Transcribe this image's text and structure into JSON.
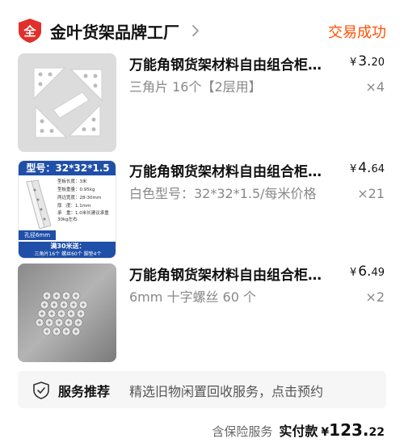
{
  "shop": {
    "logo_text": "全",
    "name": "金叶货架品牌工厂",
    "status": "交易成功"
  },
  "items": [
    {
      "title": "万能角钢货架材料自由组合柜架配件",
      "spec": "三角片 16个【2层用】",
      "currency": "¥",
      "price_int": "3.",
      "price_dec": "20",
      "qty": "×4"
    },
    {
      "title": "万能角钢货架材料自由组合柜架配件",
      "spec": "白色型号：32*32*1.5/每米价格",
      "currency": "¥",
      "price_int": "4.",
      "price_dec": "64",
      "qty": "×21",
      "thumb_text": {
        "model": "型号：32*32*1.5",
        "rows": [
          {
            "k": "型板长度：",
            "v": "3米"
          },
          {
            "k": "型板重量：",
            "v": "0.95kg"
          },
          {
            "k": "两边宽度：",
            "v": "28-30mm"
          },
          {
            "k": "厚　度：",
            "v": "1.1mm"
          },
          {
            "k": "承　重：",
            "v": "1.0米长建议承重30kg左右"
          }
        ],
        "hole": "孔径6mm",
        "promo1": "满30米送：",
        "promo2": "三角片16个 螺丝60个 脚垫4个"
      }
    },
    {
      "title": "万能角钢货架材料自由组合柜架配件",
      "spec": "6mm 十字螺丝 60 个",
      "currency": "¥",
      "price_int": "6.",
      "price_dec": "49",
      "qty": "×2"
    }
  ],
  "service": {
    "title": "服务推荐",
    "desc": "精选旧物闲置回收服务，点击预约"
  },
  "footer": {
    "insurance": "含保险服务",
    "paid_label": "实付款",
    "currency": "¥",
    "total_int": "123.",
    "total_dec": "22"
  },
  "colors": {
    "accent": "#ff5000",
    "logo_red": "#e0302a",
    "thumb_blue": "#1f4fa8"
  }
}
